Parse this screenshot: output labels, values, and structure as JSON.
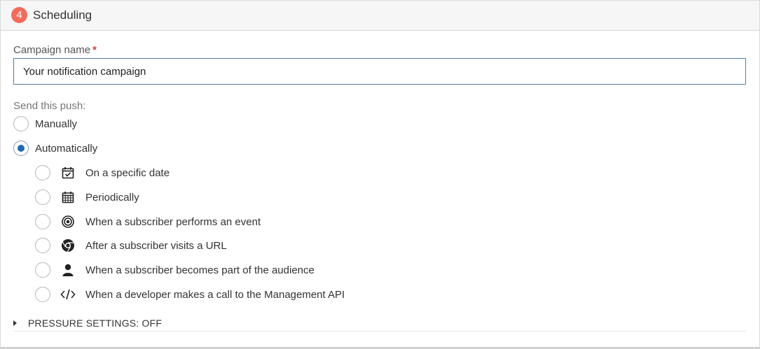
{
  "section": {
    "step_number": "4",
    "title": "Scheduling"
  },
  "campaign_name": {
    "label": "Campaign name",
    "required_mark": "*",
    "value": "Your notification campaign"
  },
  "send": {
    "label": "Send this push:",
    "options": [
      {
        "label": "Manually",
        "checked": false
      },
      {
        "label": "Automatically",
        "checked": true
      }
    ],
    "sub_options": [
      {
        "label": "On a specific date",
        "icon": "calendar-check-icon",
        "checked": false
      },
      {
        "label": "Periodically",
        "icon": "calendar-grid-icon",
        "checked": false
      },
      {
        "label": "When a subscriber performs an event",
        "icon": "target-icon",
        "checked": false
      },
      {
        "label": "After a subscriber visits a URL",
        "icon": "chrome-icon",
        "checked": false
      },
      {
        "label": "When a subscriber becomes part of the audience",
        "icon": "user-icon",
        "checked": false
      },
      {
        "label": "When a developer makes a call to the Management API",
        "icon": "code-icon",
        "checked": false
      }
    ]
  },
  "pressure_settings": {
    "label": "PRESSURE SETTINGS: OFF"
  },
  "colors": {
    "badge": "#f26b5b",
    "radio_selected": "#1f6bb5",
    "required": "#d9363e",
    "input_border": "#4a7da6"
  }
}
